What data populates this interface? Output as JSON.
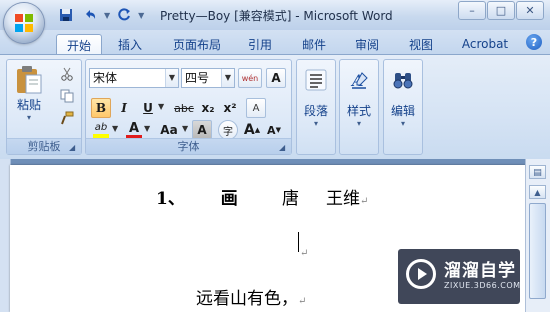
{
  "window": {
    "title": "Pretty—Boy [兼容模式] - Microsoft Word",
    "controls": [
      "–",
      "□",
      "✕"
    ]
  },
  "quick_access": {
    "save_icon": "save-icon",
    "undo_icon": "undo-icon",
    "redo_icon": "redo-icon",
    "more_icon": "chevron-down-icon"
  },
  "tabs": [
    {
      "label": "开始",
      "active": true
    },
    {
      "label": "插入"
    },
    {
      "label": "页面布局"
    },
    {
      "label": "引用"
    },
    {
      "label": "邮件"
    },
    {
      "label": "审阅"
    },
    {
      "label": "视图"
    },
    {
      "label": "Acrobat"
    }
  ],
  "help_label": "?",
  "ribbon": {
    "clipboard": {
      "paste_label": "粘贴",
      "group_label": "剪贴板"
    },
    "font": {
      "font_name": "宋体",
      "font_size": "四号",
      "wen_label": "wén",
      "change_case_label": "Aa",
      "group_label": "字体",
      "strike_label": "abc",
      "sub_label": "x₂",
      "sup_label": "x²",
      "bold_label": "B",
      "italic_label": "I",
      "underline_label": "U",
      "font_color_label": "A",
      "char_shade_label": "A",
      "grow_label": "A",
      "shrink_label": "A",
      "highlight_label": "ab",
      "clear_label": "A",
      "enclose_label": "字",
      "char_border_label": "A"
    },
    "paragraph_label": "段落",
    "styles_label": "样式",
    "editing_label": "编辑"
  },
  "document": {
    "line1_num": "1、",
    "line1_a": "画",
    "line1_b": "唐",
    "line1_c": "王维",
    "para_mark": "↵",
    "line3": "远看山有色，"
  },
  "watermark": {
    "title": "溜溜自学",
    "url": "ZIXUE.3D66.COM"
  },
  "colors": {
    "accent": "#15428b",
    "font_color_bar": "#e01b1b",
    "highlight_bar": "#ffff00"
  }
}
